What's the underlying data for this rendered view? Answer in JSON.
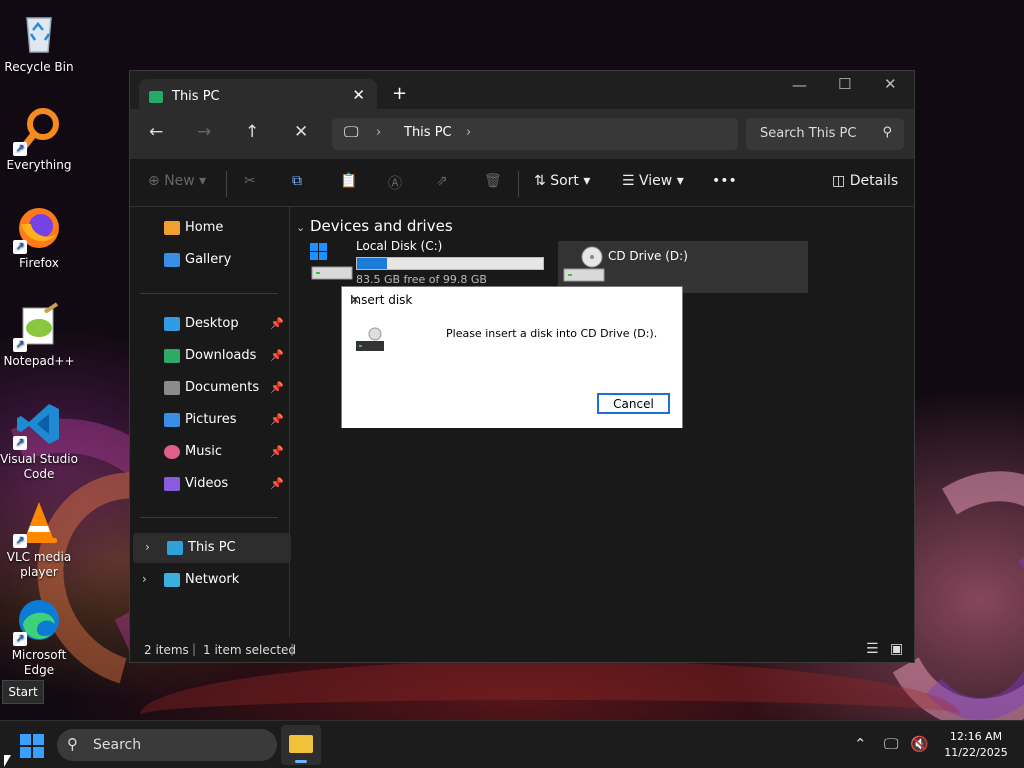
{
  "desktop": {
    "icons": [
      {
        "label": "Recycle Bin"
      },
      {
        "label": "Everything"
      },
      {
        "label": "Firefox"
      },
      {
        "label": "Notepad++"
      },
      {
        "label": "Visual Studio Code"
      },
      {
        "label": "VLC media player"
      },
      {
        "label": "Microsoft Edge"
      }
    ],
    "tooltip": "Start"
  },
  "explorer": {
    "tab_title": "This PC",
    "address": {
      "location": "This PC"
    },
    "search_placeholder": "Search This PC",
    "commands": {
      "new": "New",
      "sort": "Sort",
      "view": "View",
      "more": "•••",
      "details": "Details"
    },
    "sidebar": {
      "top": [
        {
          "label": "Home"
        },
        {
          "label": "Gallery"
        }
      ],
      "quick": [
        {
          "label": "Desktop"
        },
        {
          "label": "Downloads"
        },
        {
          "label": "Documents"
        },
        {
          "label": "Pictures"
        },
        {
          "label": "Music"
        },
        {
          "label": "Videos"
        }
      ],
      "tree": [
        {
          "label": "This PC"
        },
        {
          "label": "Network"
        }
      ]
    },
    "group_header": "Devices and drives",
    "drives": [
      {
        "name": "Local Disk (C:)",
        "free_text": "83.5 GB free of 99.8 GB",
        "used_fraction": 0.163
      },
      {
        "name": "CD Drive (D:)"
      }
    ],
    "status": {
      "items": "2 items",
      "selected": "1 item selected"
    }
  },
  "dialog": {
    "title": "Insert disk",
    "message": "Please insert a disk into CD Drive (D:).",
    "cancel": "Cancel"
  },
  "taskbar": {
    "search": "Search",
    "time": "12:16 AM",
    "date": "11/22/2025"
  },
  "colors": {
    "accent": "#1c7ad8",
    "folder": "#f2c13a"
  }
}
